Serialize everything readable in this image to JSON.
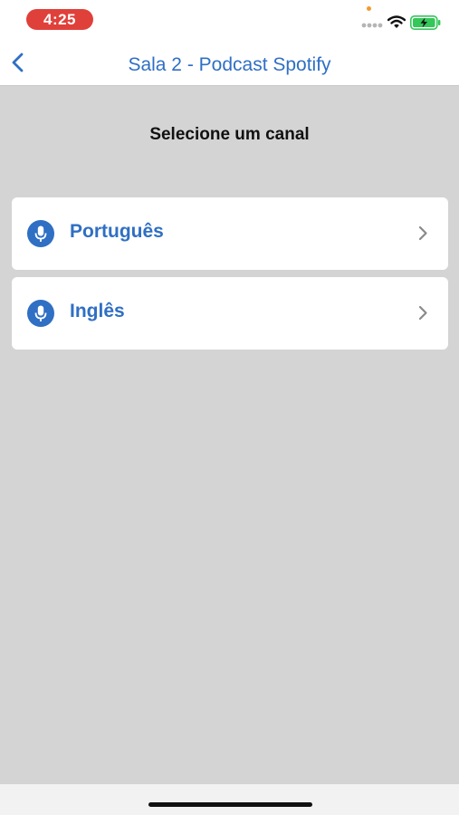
{
  "status_bar": {
    "time": "4:25",
    "icons": [
      "privacy-dot-icon",
      "cellular-signal-icon",
      "wifi-icon",
      "battery-charging-icon"
    ]
  },
  "nav_bar": {
    "back_icon": "chevron-left-icon",
    "title": "Sala 2 - Podcast Spotify"
  },
  "main": {
    "section_title": "Selecione um canal",
    "channels": [
      {
        "label": "Português",
        "icon": "microphone-icon",
        "trailing_icon": "chevron-right-icon"
      },
      {
        "label": "Inglês",
        "icon": "microphone-icon",
        "trailing_icon": "chevron-right-icon"
      }
    ]
  },
  "colors": {
    "accent": "#2f6fc4",
    "background": "#d4d4d4",
    "time_pill": "#e0403a",
    "battery": "#34c759"
  }
}
